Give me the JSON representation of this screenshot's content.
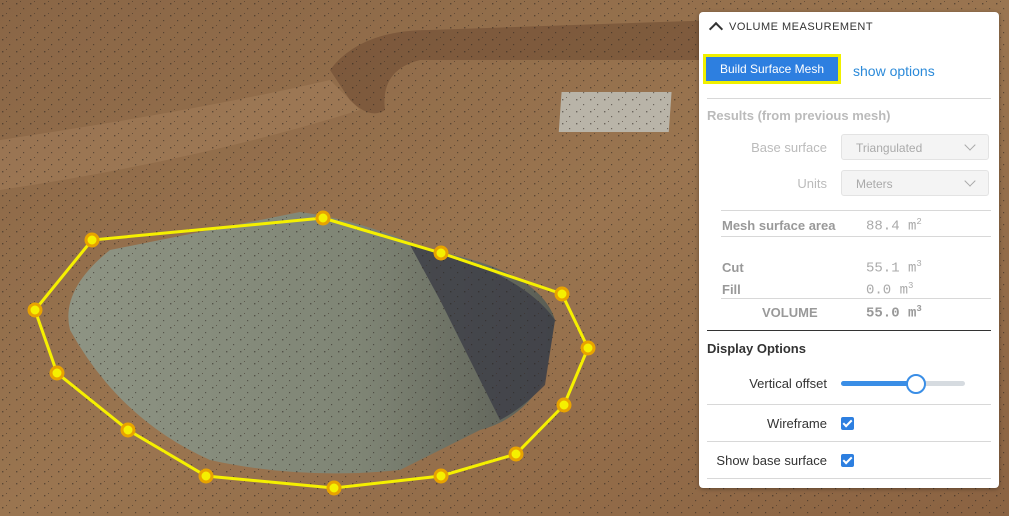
{
  "panel": {
    "title": "VOLUME MEASUREMENT",
    "build_button": "Build Surface Mesh",
    "show_options": "show options",
    "results_title": "Results (from previous mesh)",
    "base_surface_label": "Base surface",
    "base_surface_value": "Triangulated",
    "units_label": "Units",
    "units_value": "Meters",
    "mesh_area_label": "Mesh surface area",
    "mesh_area_value": "88.4 m",
    "area_unit_power": "2",
    "cut_label": "Cut",
    "cut_value": "55.1 m",
    "fill_label": "Fill",
    "fill_value": "0.0 m",
    "volume_label": "VOLUME",
    "volume_value": "55.0 m",
    "volume_unit_power": "3",
    "display_options_title": "Display Options",
    "vertical_offset_label": "Vertical offset",
    "vertical_offset_level": 0.6,
    "wireframe_label": "Wireframe",
    "wireframe_checked": true,
    "show_base_label": "Show base surface",
    "show_base_checked": true
  },
  "colors": {
    "accent": "#2d7fe0",
    "highlight": "#f0f000",
    "polygon": "#f5f000"
  },
  "icons": [
    "chevron-up-icon",
    "chevron-down-icon",
    "checkbox-checked-icon"
  ]
}
